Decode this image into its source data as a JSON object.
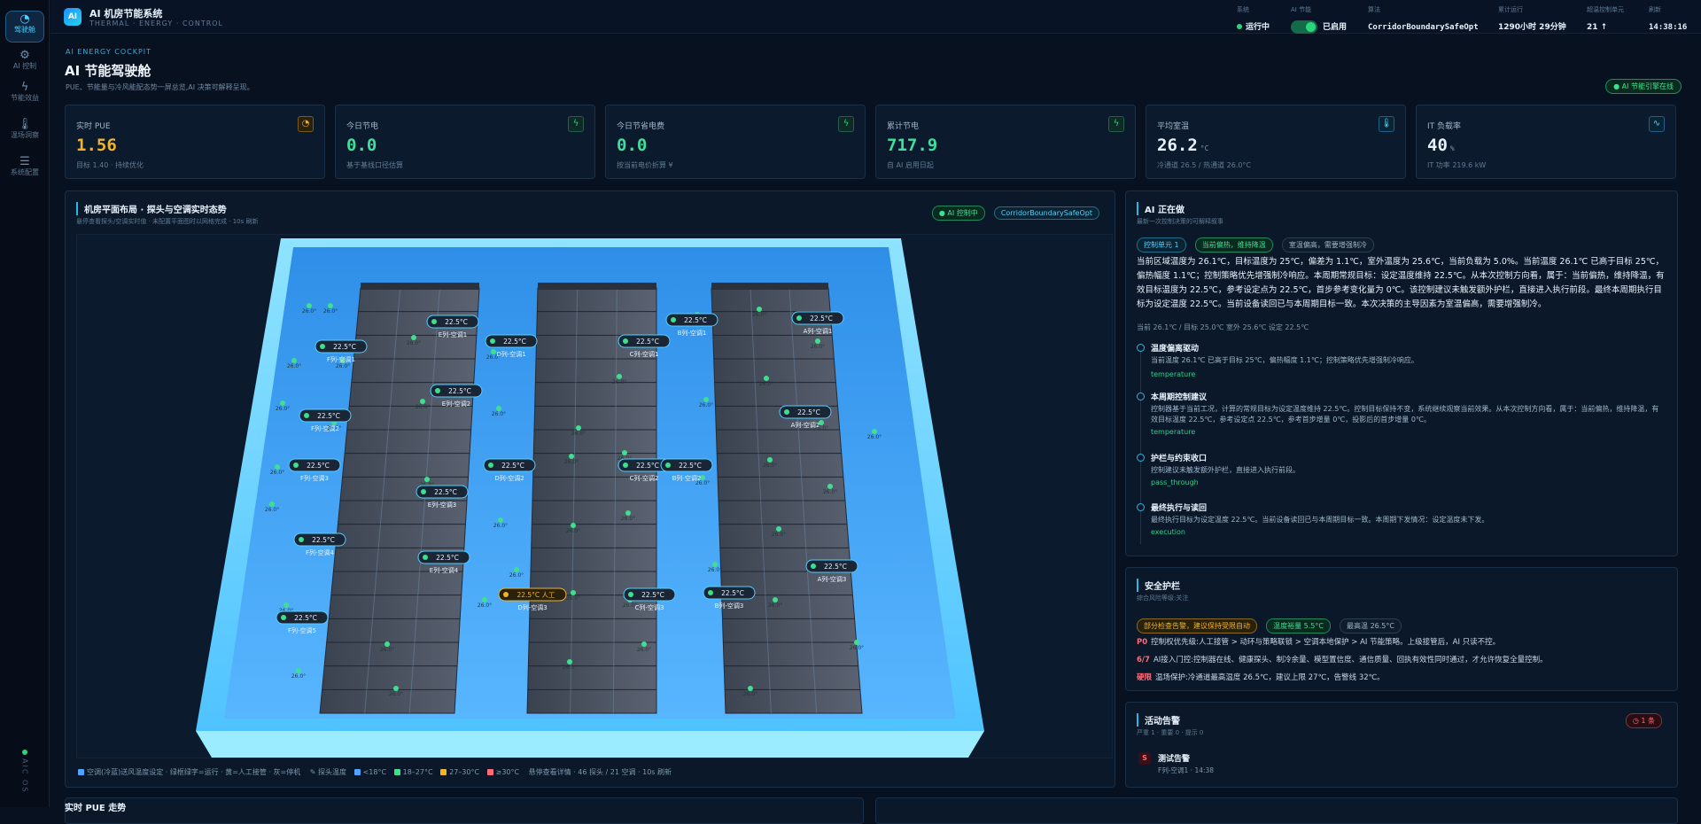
{
  "app": {
    "logo": "AI",
    "title": "AI 机房节能系统",
    "subtitle": "THERMAL · ENERGY · CONTROL"
  },
  "sidebar": {
    "items": [
      {
        "label": "驾驶舱",
        "icon": "gauge-icon"
      },
      {
        "label": "AI 控制",
        "icon": "gear-icon"
      },
      {
        "label": "节能效益",
        "icon": "bolt-icon"
      },
      {
        "label": "温场洞察",
        "icon": "thermometer-icon"
      },
      {
        "label": "系统配置",
        "icon": "sliders-icon"
      }
    ],
    "footer": "AIC OS"
  },
  "topstats": [
    {
      "label": "系统",
      "value": "运行中"
    },
    {
      "label": "AI 节能",
      "value": "已启用"
    },
    {
      "label": "算法",
      "value": "CorridorBoundarySafeOpt"
    },
    {
      "label": "累计运行",
      "value": "1290小时 29分钟"
    },
    {
      "label": "超温控制单元",
      "value": "21",
      "arrow": "↑"
    },
    {
      "label": "刷新",
      "value": "14:38:16"
    }
  ],
  "page": {
    "kicker": "AI ENERGY COCKPIT",
    "title": "AI 节能驾驶舱",
    "desc": "PUE、节能量与冷风能配态势一屏总览,AI 决策可解释呈现。",
    "badge": "● AI 节能引擎在线"
  },
  "kpis": [
    {
      "label": "实时 PUE",
      "value": "1.56",
      "unit": "",
      "sub": "目标 1.40 · 持续优化",
      "color": "#f0b429",
      "icon": "gauge-icon"
    },
    {
      "label": "今日节电",
      "value": "0.0",
      "unit": "",
      "sub": "基于基线口径估算",
      "color": "#3ee0a0",
      "icon": "bolt-icon"
    },
    {
      "label": "今日节省电费",
      "value": "0.0",
      "unit": "",
      "sub": "按当前电价折算 ¥",
      "color": "#3ee0a0",
      "icon": "bolt-icon"
    },
    {
      "label": "累计节电",
      "value": "717.9",
      "unit": "",
      "sub": "自 AI 启用日起",
      "color": "#3ee0a0",
      "icon": "bolt-icon"
    },
    {
      "label": "平均室温",
      "value": "26.2",
      "unit": "°C",
      "sub": "冷通道 26.5 / 热通道 26.0°C",
      "color": "#e6f1fb",
      "icon": "thermometer-icon"
    },
    {
      "label": "IT 负载率",
      "value": "40",
      "unit": "%",
      "sub": "IT 功率 219.6 kW",
      "color": "#e6f1fb",
      "icon": "pulse-icon"
    }
  ],
  "map": {
    "title": "机房平面布局 · 探头与空调实时态势",
    "subtitle": "悬停查看探头/空调实时值 · 未配置平面图时以网格完成 · 10s 刷新",
    "tags": [
      "● AI 控制中",
      "CorridorBoundarySafeOpt"
    ],
    "ac_units": [
      {
        "label": "F列-空调1",
        "temp": "22.5°C"
      },
      {
        "label": "E列-空调1",
        "temp": "22.5°C"
      },
      {
        "label": "D列-空调1",
        "temp": "22.5°C"
      },
      {
        "label": "C列-空调1",
        "temp": "22.5°C"
      },
      {
        "label": "B列-空调1",
        "temp": "22.5°C"
      },
      {
        "label": "A列-空调1",
        "temp": "22.5°C"
      },
      {
        "label": "E列-空调2",
        "temp": "22.5°C"
      },
      {
        "label": "F列-空调2",
        "temp": "22.5°C"
      },
      {
        "label": "A列-空调2",
        "temp": "22.5°C"
      },
      {
        "label": "F列-空调3",
        "temp": "22.5°C"
      },
      {
        "label": "D列-空调2",
        "temp": "22.5°C"
      },
      {
        "label": "C列-空调2",
        "temp": "22.5°C"
      },
      {
        "label": "B列-空调2",
        "temp": "22.5°C"
      },
      {
        "label": "E列-空调3",
        "temp": "22.5°C"
      },
      {
        "label": "F列-空调4",
        "temp": "22.5°C"
      },
      {
        "label": "E列-空调4",
        "temp": "22.5°C"
      },
      {
        "label": "A列-空调3",
        "temp": "22.5°C"
      },
      {
        "label": "D列-空调3",
        "temp": "22.5°C 人工",
        "manual": true
      },
      {
        "label": "C列-空调3",
        "temp": "22.5°C"
      },
      {
        "label": "B列-空调3",
        "temp": "22.5°C"
      },
      {
        "label": "F列-空调5",
        "temp": "22.5°C"
      }
    ],
    "probe_value": "26.0°",
    "legend": {
      "ac": "空调(冷蓝)送风温度设定 · 绿框绿字=运行 · 黄=人工接管 · 灰=停机",
      "probe": "探头温度",
      "ranges": [
        {
          "label": "<18°C",
          "color": "#4fa3ff"
        },
        {
          "label": "18–27°C",
          "color": "#3ee08f"
        },
        {
          "label": "27–30°C",
          "color": "#f0b429"
        },
        {
          "label": "≥30°C",
          "color": "#ff6b7a"
        }
      ],
      "detail": "悬停查看详情 · 46 探头 / 21 空调 · 10s 刷新"
    }
  },
  "ai": {
    "title": "AI 正在做",
    "subtitle": "最新一次控制决策的可解释叙事",
    "tags": [
      "控制单元 1",
      "当前偏热，维持降温",
      "室温偏高，需要增强制冷"
    ],
    "narrative": "当前区域温度为 26.1℃，目标温度为 25℃，偏差为 1.1℃，室外温度为 25.6℃，当前负载为 5.0%。当前温度 26.1℃ 已高于目标 25℃，偏热幅度 1.1℃；控制策略优先增强制冷响应。本周期常规目标：设定温度维持 22.5℃。从本次控制方向看，属于：当前偏热，维持降温，有效目标温度为 22.5℃，参考设定点为 22.5℃，首步参考变化量为 0℃。该控制建议未触发额外护栏，直接进入执行前段。最终本周期执行目标为设定温度 22.5℃。当前设备读回已与本周期目标一致。本次决策的主导因素为室温偏高，需要增强制冷。",
    "meta": "当前 26.1℃ / 目标 25.0℃   室外 25.6℃   设定 22.5℃",
    "steps": [
      {
        "title": "温度偏离驱动",
        "text": "当前温度 26.1℃ 已高于目标 25℃，偏热幅度 1.1℃；控制策略优先增强制冷响应。",
        "code": "temperature"
      },
      {
        "title": "本周期控制建议",
        "text": "控制器基于当前工况，计算的常规目标为设定温度维持 22.5℃。控制目标保持不变，系统继续观察当前效果。从本次控制方向看，属于：当前偏热，维持降温，有效目标温度 22.5℃，参考设定点 22.5℃，参考首步增量 0℃，投影后的首步增量 0℃。",
        "code": "temperature"
      },
      {
        "title": "护栏与约束收口",
        "text": "控制建议未触发额外护栏，直接进入执行前段。",
        "code": "pass_through"
      },
      {
        "title": "最终执行与读回",
        "text": "最终执行目标为设定温度 22.5℃。当前设备读回已与本周期目标一致。本周期下发情况：设定温度未下发。",
        "code": "execution"
      }
    ]
  },
  "safety": {
    "title": "安全护栏",
    "subtitle": "综合风险等级:关注",
    "tags": [
      "部分检查告警，建议保持受限自动",
      "温度裕量 5.5°C",
      "最高温 26.5°C"
    ],
    "rules": [
      {
        "tag": "P0",
        "text": "控制权优先级:人工接管 > 动环与策略联锁 > 空调本地保护 > AI 节能策略。上级接管后，AI 只读不控。",
        "color": "#ff6b7a"
      },
      {
        "tag": "6/7",
        "text": "AI接入门控:控制器在线、健康探头、制冷余量、模型置信度、通信质量、回执有效性同时通过，才允许恢复全量控制。",
        "color": "#ff6b7a"
      },
      {
        "tag": "硬限",
        "text": "温场保护:冷通道最高温度 26.5℃，建议上限 27℃，告警线 32℃。",
        "color": "#ff6b7a"
      }
    ]
  },
  "alarms": {
    "title": "活动告警",
    "subtitle": "严重 1 · 重要 0 · 提示 0",
    "badge": "◷ 1 条",
    "items": [
      {
        "level": "S",
        "title": "测试告警",
        "meta": "F列-空调1 · 14:38"
      }
    ]
  },
  "bottom": {
    "title": "实时 PUE 走势"
  }
}
